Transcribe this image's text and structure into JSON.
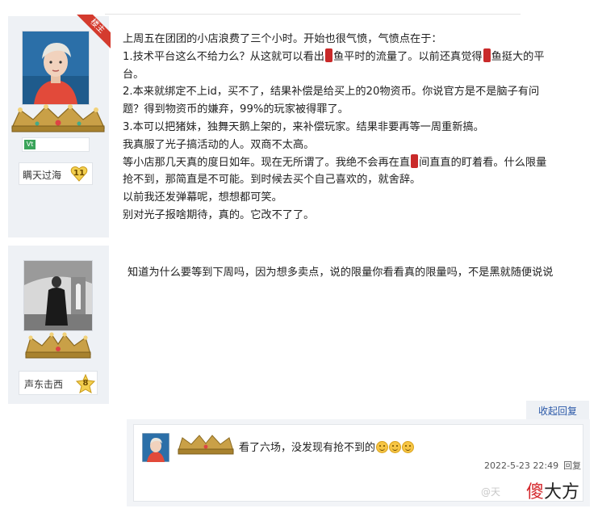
{
  "post1": {
    "op_badge": "楼主",
    "username": "瞒天过海",
    "level": "11",
    "badge_mark": "Vt",
    "lines": [
      "上周五在团团的小店浪费了三个小时。开始也很气愤，气愤点在于：",
      [
        "1.技术平台这么不给力么？从这就可以看出",
        "鱼平时的流量了。以前还真觉得",
        "鱼挺大的平"
      ],
      "台。",
      "2.本来就绑定不上id，买不了，结果补偿是给买上的20物资币。你说官方是不是脑子有问",
      "题？得到物资币的嫌弃，99%的玩家被得罪了。",
      "3.本可以把猪妹，独舞天鹅上架的，来补偿玩家。结果非要再等一周重新搞。",
      "我真服了光子搞活动的人。双商不太高。",
      [
        "等小店那几天真的度日如年。现在无所谓了。我绝不会再在直",
        "间直直的盯着看。什么限量"
      ],
      "抢不到，那简直是不可能。到时候去买个自己喜欢的，就舍辞。",
      "以前我还发弹幕呢，想想都可笑。",
      "别对光子报啥期待，真的。它改不了了。"
    ]
  },
  "post2": {
    "username": "声东击西",
    "level": "8",
    "text": "知道为什么要等到下周吗，因为想多卖点，说的限量你看看真的限量吗，不是黑就随便说说"
  },
  "collapse_label": "收起回复",
  "sub_reply": {
    "text": "看了六场，没发现有抢不到的",
    "timestamp": "2022-5-23 22:49",
    "reply_label": "回复"
  },
  "watermark": {
    "left": "@天",
    "brand_red": "傻",
    "brand_dark": "大方"
  },
  "colors": {
    "accent_red": "#d43b2e",
    "link_blue": "#2a58a8",
    "side_bg": "#eef1f5",
    "crown_gold": "#c9a047"
  }
}
